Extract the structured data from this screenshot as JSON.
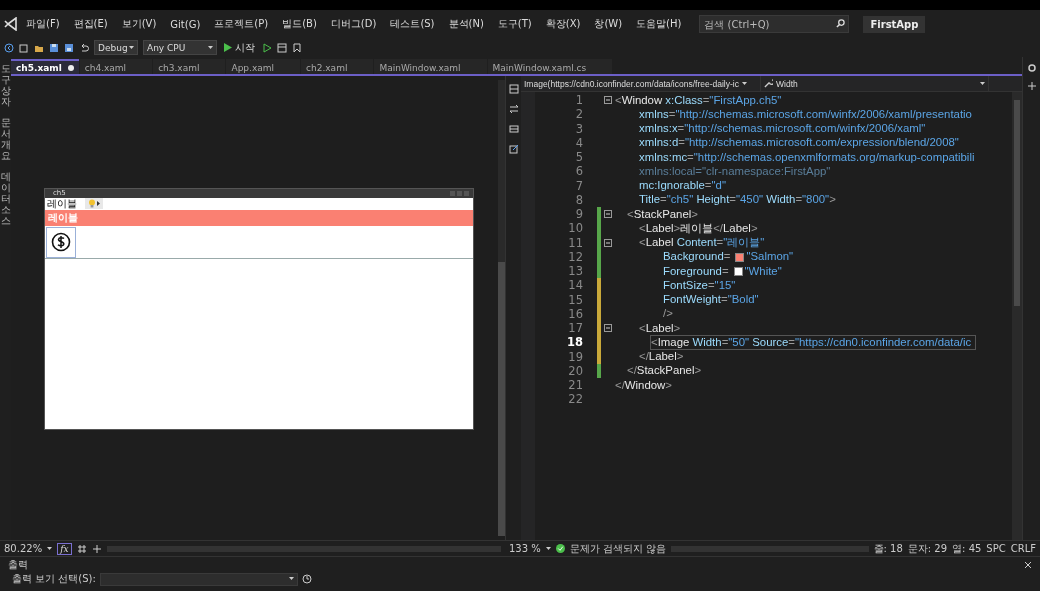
{
  "menu": [
    "파일(F)",
    "편집(E)",
    "보기(V)",
    "Git(G)",
    "프로젝트(P)",
    "빌드(B)",
    "디버그(D)",
    "테스트(S)",
    "분석(N)",
    "도구(T)",
    "확장(X)",
    "창(W)",
    "도움말(H)"
  ],
  "search": {
    "placeholder": "검색 (Ctrl+Q)"
  },
  "solution": "FirstApp",
  "toolbar": {
    "configuration": "Debug",
    "platform": "Any CPU",
    "start": "시작"
  },
  "side_tabs": [
    "도구 상자",
    "문서 개요",
    "데이터 소스"
  ],
  "tabs": [
    {
      "label": "ch5.xaml",
      "selected": true,
      "modified": true
    },
    {
      "label": "ch4.xaml",
      "selected": false,
      "modified": false
    },
    {
      "label": "ch3.xaml",
      "selected": false,
      "modified": false
    },
    {
      "label": "App.xaml",
      "selected": false,
      "modified": false
    },
    {
      "label": "ch2.xaml",
      "selected": false,
      "modified": false
    },
    {
      "label": "MainWindow.xaml",
      "selected": false,
      "modified": false
    },
    {
      "label": "MainWindow.xaml.cs",
      "selected": false,
      "modified": false
    }
  ],
  "designer": {
    "window_title": "ch5",
    "label": "레이블",
    "salmon_label": "레이블",
    "zoom": "80.22%",
    "formula_button": "fx"
  },
  "editor": {
    "element": "Image(https://cdn0.iconfinder.com/data/icons/free-daily-ic",
    "property": "Width",
    "zoom": "133 %",
    "issues": "문제가 검색되지 않음",
    "line": "줄: 18",
    "char": "문자: 29",
    "col": "열: 45",
    "whitespace": "SPC",
    "line_ending": "CRLF",
    "lines": [
      {
        "n": "1",
        "kind": "code",
        "text": "<Window x:Class=\"FirstApp.ch5\"",
        "fold": true,
        "current": false
      },
      {
        "n": "2",
        "kind": "code",
        "text": "xmlns=\"http://schemas.microsoft.com/winfx/2006/xaml/presentatio",
        "fold": false,
        "current": false
      },
      {
        "n": "3",
        "kind": "code",
        "text": "xmlns:x=\"http://schemas.microsoft.com/winfx/2006/xaml\"",
        "fold": false,
        "current": false
      },
      {
        "n": "4",
        "kind": "code",
        "text": "xmlns:d=\"http://schemas.microsoft.com/expression/blend/2008\"",
        "fold": false,
        "current": false
      },
      {
        "n": "5",
        "kind": "code",
        "text": "xmlns:mc=\"http://schemas.openxmlformats.org/markup-compatibili",
        "fold": false,
        "current": false
      },
      {
        "n": "6",
        "kind": "unused",
        "text": "xmlns:local=\"clr-namespace:FirstApp\"",
        "fold": false,
        "current": false
      },
      {
        "n": "7",
        "kind": "code",
        "text": "mc:Ignorable=\"d\"",
        "fold": false,
        "current": false
      },
      {
        "n": "8",
        "kind": "code",
        "text": "Title=\"ch5\" Height=\"450\" Width=\"800\">",
        "fold": false,
        "current": false
      },
      {
        "n": "9",
        "kind": "code",
        "text": "<StackPanel>",
        "fold": true,
        "current": false,
        "color": "#57a64a"
      },
      {
        "n": "10",
        "kind": "code",
        "text": "<Label>레이블</Label>",
        "fold": false,
        "current": false,
        "color": "#57a64a"
      },
      {
        "n": "11",
        "kind": "code",
        "text": "<Label Content=\"레이블\"",
        "fold": true,
        "current": false,
        "color": "#57a64a"
      },
      {
        "n": "12",
        "kind": "code",
        "text": "Background=",
        "swatch": {
          "color": "#fa8072",
          "value": "\"Salmon\""
        },
        "fold": false,
        "current": false,
        "color": "#57a64a"
      },
      {
        "n": "13",
        "kind": "code",
        "text": "Foreground=",
        "swatch": {
          "color": "#ffffff",
          "value": "\"White\""
        },
        "fold": false,
        "current": false,
        "color": "#57a64a"
      },
      {
        "n": "14",
        "kind": "code",
        "text": "FontSize=\"15\"",
        "fold": false,
        "current": false,
        "color": "#c9a93a"
      },
      {
        "n": "15",
        "kind": "code",
        "text": "FontWeight=\"Bold\"",
        "fold": false,
        "current": false,
        "color": "#c9a93a"
      },
      {
        "n": "16",
        "kind": "code",
        "text": "/>",
        "fold": false,
        "current": false,
        "color": "#c9a93a"
      },
      {
        "n": "17",
        "kind": "code",
        "text": "<Label>",
        "fold": true,
        "current": false,
        "color": "#c9a93a"
      },
      {
        "n": "18",
        "kind": "code",
        "text": "<Image Width=\"50\" Source=\"https://cdn0.iconfinder.com/data/ic",
        "fold": false,
        "current": true,
        "color": "#c9a93a"
      },
      {
        "n": "19",
        "kind": "code",
        "text": "</Label>",
        "fold": false,
        "current": false,
        "color": "#c9a93a"
      },
      {
        "n": "20",
        "kind": "code",
        "text": "</StackPanel>",
        "fold": false,
        "current": false,
        "color": "#57a64a"
      },
      {
        "n": "21",
        "kind": "code",
        "text": "</Window>",
        "fold": false,
        "current": false
      },
      {
        "n": "22",
        "kind": "blank",
        "fold": false,
        "current": false
      }
    ]
  },
  "output": {
    "title": "출력",
    "source_label": "출력 보기 선택(S):"
  }
}
